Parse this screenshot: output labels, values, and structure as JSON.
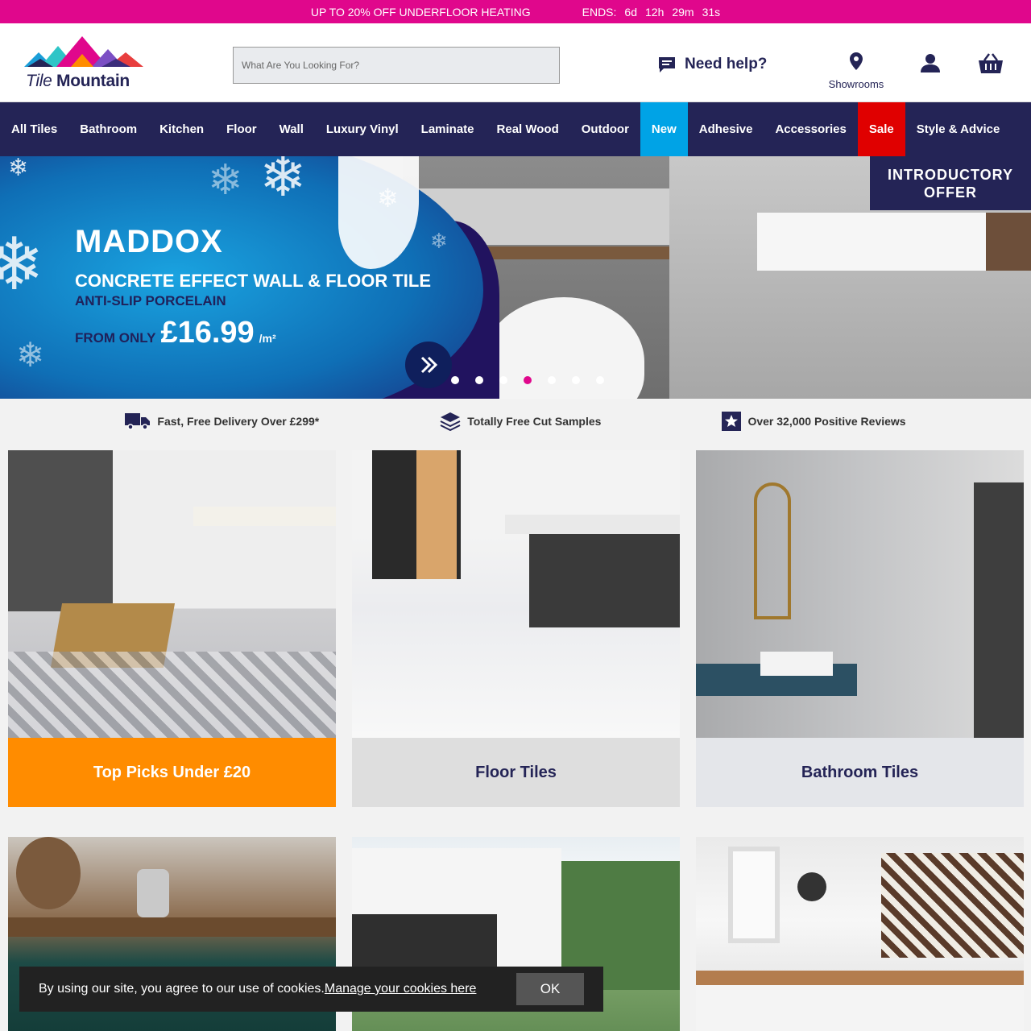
{
  "promo": {
    "text": "UP TO 20% OFF UNDERFLOOR HEATING",
    "ends_label": "ENDS:",
    "days": "6d",
    "hours": "12h",
    "minutes": "29m",
    "seconds": "31s"
  },
  "header": {
    "logo_tile": "Tile",
    "logo_mountain": "Mountain",
    "search_placeholder": "What Are You Looking For?",
    "help_label": "Need help?",
    "showrooms_label": "Showrooms"
  },
  "nav": [
    {
      "label": "All Tiles"
    },
    {
      "label": "Bathroom"
    },
    {
      "label": "Kitchen"
    },
    {
      "label": "Floor"
    },
    {
      "label": "Wall"
    },
    {
      "label": "Luxury Vinyl"
    },
    {
      "label": "Laminate"
    },
    {
      "label": "Real Wood"
    },
    {
      "label": "Outdoor"
    },
    {
      "label": "New"
    },
    {
      "label": "Adhesive"
    },
    {
      "label": "Accessories"
    },
    {
      "label": "Sale"
    },
    {
      "label": "Style & Advice"
    }
  ],
  "hero": {
    "title": "MADDOX",
    "subtitle": "CONCRETE EFFECT WALL & FLOOR TILE",
    "subtitle2": "ANTI-SLIP PORCELAIN",
    "from_label": "FROM ONLY",
    "price": "£16.99",
    "unit": "/m²",
    "badge_line1": "INTRODUCTORY",
    "badge_line2": "OFFER",
    "slide_count": 7,
    "active_slide": 4
  },
  "usps": [
    {
      "icon": "truck-icon",
      "text": "Fast, Free Delivery Over £299*"
    },
    {
      "icon": "layers-icon",
      "text": "Totally Free Cut Samples"
    },
    {
      "icon": "star-icon",
      "text": "Over 32,000 Positive Reviews"
    }
  ],
  "categories": [
    {
      "label": "Top Picks Under £20"
    },
    {
      "label": "Floor Tiles"
    },
    {
      "label": "Bathroom Tiles"
    }
  ],
  "cookie": {
    "text": "By using our site, you agree to our use of cookies.",
    "link": "Manage your cookies here",
    "ok": "OK"
  },
  "colors": {
    "brand_navy": "#242456",
    "promo_pink": "#e0078c",
    "new_blue": "#00a3e6",
    "sale_red": "#e00000",
    "orange": "#ff8c00"
  }
}
